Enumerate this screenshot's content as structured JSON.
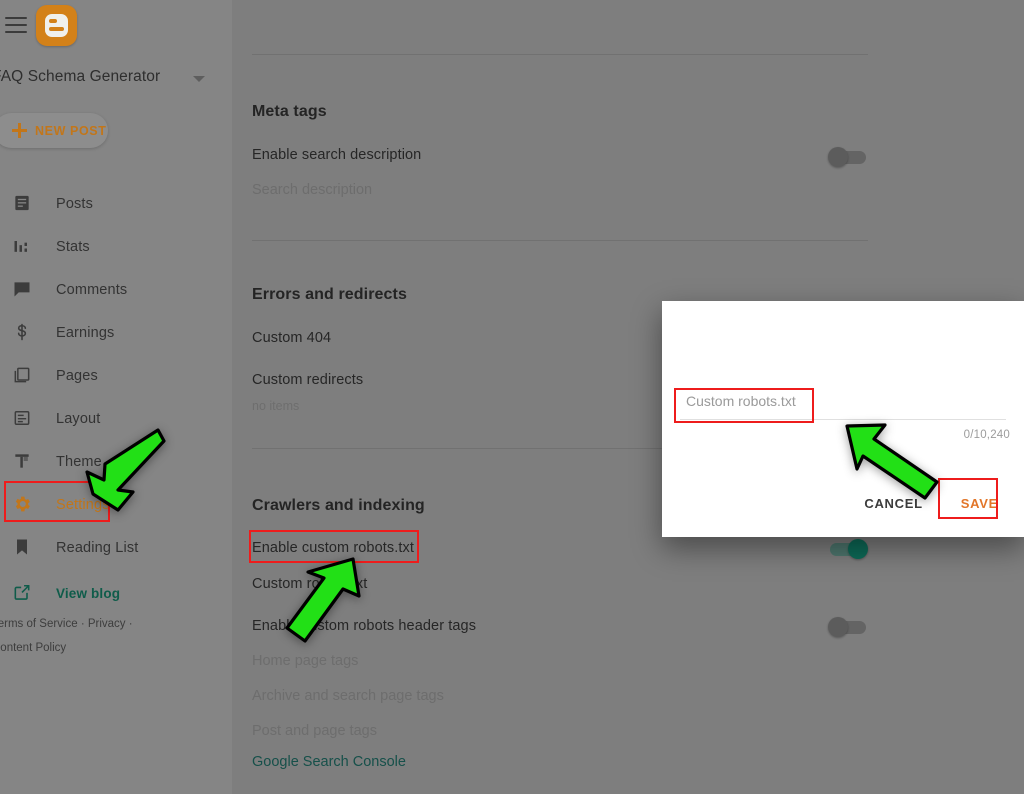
{
  "app": {
    "name": "Blogger",
    "logo_icon": "blogger-logo-icon",
    "menu_icon": "hamburger-menu-icon"
  },
  "sidebar": {
    "blog_title": "FAQ Schema Generator",
    "blog_dropdown_icon": "chevron-down-icon",
    "new_post_label": "NEW POST",
    "new_post_icon": "plus-icon",
    "items": [
      {
        "label": "Posts",
        "icon": "posts-icon",
        "active": false
      },
      {
        "label": "Stats",
        "icon": "stats-icon",
        "active": false
      },
      {
        "label": "Comments",
        "icon": "comments-icon",
        "active": false
      },
      {
        "label": "Earnings",
        "icon": "earnings-dollar-icon",
        "active": false
      },
      {
        "label": "Pages",
        "icon": "pages-icon",
        "active": false
      },
      {
        "label": "Layout",
        "icon": "layout-icon",
        "active": false
      },
      {
        "label": "Theme",
        "icon": "theme-icon",
        "active": false
      },
      {
        "label": "Settings",
        "icon": "gear-icon",
        "active": true
      },
      {
        "label": "Reading List",
        "icon": "bookmark-icon",
        "active": false
      }
    ],
    "view_blog": {
      "label": "View blog",
      "icon": "external-link-icon"
    },
    "footer_line1": "Terms of Service · Privacy ·",
    "footer_line2": "Content Policy"
  },
  "main": {
    "sections": [
      {
        "title": "Meta tags",
        "rows": [
          {
            "label": "Enable search description",
            "type": "toggle",
            "state": "off"
          },
          {
            "label": "Search description",
            "type": "muted"
          }
        ]
      },
      {
        "title": "Errors and redirects",
        "rows": [
          {
            "label": "Custom 404",
            "type": "label"
          },
          {
            "label": "Custom redirects",
            "type": "label",
            "sub": "no items"
          }
        ]
      },
      {
        "title": "Crawlers and indexing",
        "rows": [
          {
            "label": "Enable custom robots.txt",
            "type": "toggle",
            "state": "on"
          },
          {
            "label": "Custom robots.txt",
            "type": "label"
          },
          {
            "label": "Enable custom robots header tags",
            "type": "toggle",
            "state": "off"
          },
          {
            "label": "Home page tags",
            "type": "muted"
          },
          {
            "label": "Archive and search page tags",
            "type": "muted"
          },
          {
            "label": "Post and page tags",
            "type": "muted"
          },
          {
            "label": "Google Search Console",
            "type": "link"
          }
        ]
      }
    ]
  },
  "modal": {
    "input_placeholder": "Custom robots.txt",
    "input_value": "",
    "char_counter": "0/10,240",
    "cancel_label": "CANCEL",
    "save_label": "SAVE"
  },
  "annotations": {
    "highlight_color": "#ee1c1c",
    "arrow_color": "#22e016",
    "highlights": [
      "settings-nav-item",
      "enable-custom-robots-txt-label",
      "custom-robots-txt-input",
      "save-button"
    ],
    "arrows": [
      "arrow-to-settings",
      "arrow-to-enable-custom-robots-txt",
      "arrow-to-custom-robots-txt-input"
    ]
  }
}
